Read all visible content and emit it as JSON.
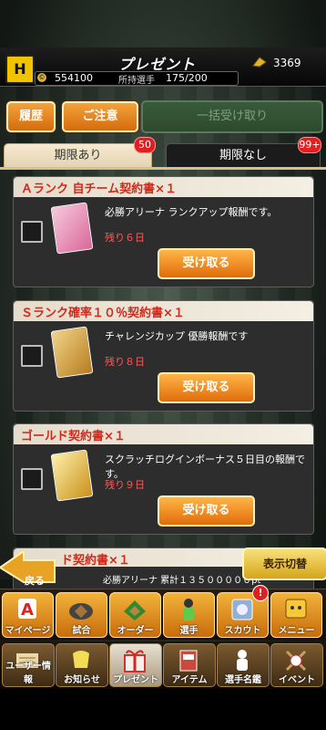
{
  "header": {
    "logo_text": "H",
    "title": "プレゼント",
    "gold": "3369",
    "coins": "554100",
    "players_label": "所持選手",
    "players": "175/200",
    "coin_icon_text": "©"
  },
  "actions": {
    "history": "履歴",
    "caution": "ご注意",
    "receive_all": "一括受け取り"
  },
  "tabs": [
    {
      "label": "期限あり",
      "badge": "50"
    },
    {
      "label": "期限なし",
      "badge": "99+"
    }
  ],
  "items": [
    {
      "title": "Ａランク 自チーム契約書×１",
      "desc": "必勝アリーナ ランクアップ報酬です。",
      "remaining": "残り６日",
      "button": "受け取る",
      "img_color": "#e48fb5"
    },
    {
      "title": "Ｓランク確率１０％契約書×１",
      "desc": "チャレンジカップ 優勝報酬です",
      "remaining": "残り８日",
      "button": "受け取る",
      "img_color": "#d9a63a"
    },
    {
      "title": "ゴールド契約書×１",
      "desc": "スクラッチログインボーナス５日目の報酬です。",
      "remaining": "残り９日",
      "button": "受け取る",
      "img_color": "#f0c33c"
    }
  ],
  "partial_item": {
    "title": "ド契約書×１",
    "desc": "必勝アリーナ 累計１３５０００００pt"
  },
  "back_label": "戻る",
  "toggle_label": "表示切替",
  "nav_main": [
    {
      "label": "マイページ",
      "icon": "mypage-icon"
    },
    {
      "label": "試合",
      "icon": "stadium-icon"
    },
    {
      "label": "オーダー",
      "icon": "lineup-icon"
    },
    {
      "label": "選手",
      "icon": "player-icon"
    },
    {
      "label": "スカウト",
      "icon": "scout-icon"
    },
    {
      "label": "メニュー",
      "icon": "menu-icon"
    }
  ],
  "nav_sub": [
    {
      "label": "ユーザー情報",
      "icon": "user-info-icon"
    },
    {
      "label": "お知らせ",
      "icon": "notice-icon"
    },
    {
      "label": "プレゼント",
      "icon": "present-icon"
    },
    {
      "label": "アイテム",
      "icon": "item-icon"
    },
    {
      "label": "選手名鑑",
      "icon": "roster-icon"
    },
    {
      "label": "イベント",
      "icon": "event-icon"
    }
  ],
  "scout_alert": "!"
}
